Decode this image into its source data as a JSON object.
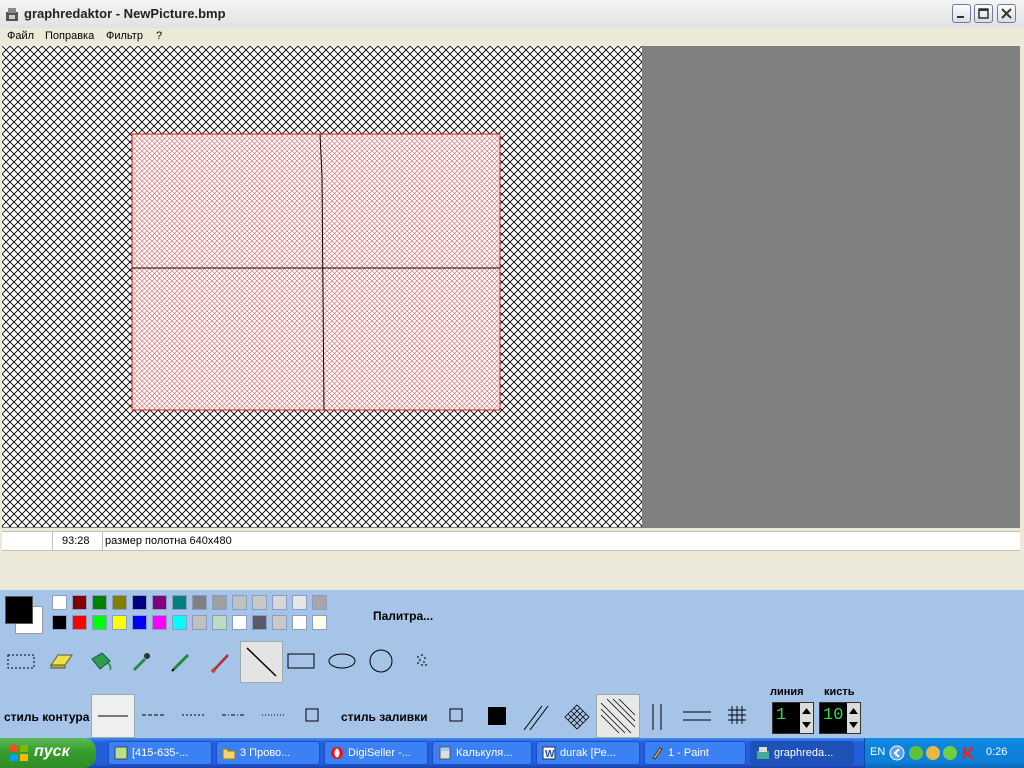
{
  "window": {
    "title": "graphredaktor - NewPicture.bmp"
  },
  "menu": {
    "items": [
      "Файл",
      "Поправка",
      "Фильтр",
      "?"
    ]
  },
  "status": {
    "cell1": "",
    "coords": "93:28",
    "message": "размер полотна 640x480"
  },
  "palette": {
    "label": "Палитра...",
    "primary": "#000000",
    "secondary": "#ffffff",
    "row1": [
      "#ffffff",
      "#800000",
      "#008000",
      "#808000",
      "#000080",
      "#800080",
      "#008080",
      "#808080",
      "#a0a0a0",
      "#c0c0c0",
      "#c8c8c8",
      "#d8d8d8",
      "#e6e6e6",
      "#a6a6a6"
    ],
    "row2": [
      "#000000",
      "#ff0000",
      "#00ff00",
      "#ffff00",
      "#0000ff",
      "#ff00ff",
      "#00ffff",
      "#c0c0c0",
      "#c0dcc0",
      "#ffffff",
      "#5a5a6a",
      "#c8c8c8",
      "#ffffff",
      "#ffffe8"
    ]
  },
  "tools": [
    "rect-select",
    "eraser",
    "fill",
    "eyedropper",
    "pencil",
    "brush",
    "line",
    "rectangle",
    "ellipse",
    "circle",
    "spray"
  ],
  "styles": {
    "outline_label": "стиль контура",
    "fill_label": "стиль заливки"
  },
  "spinners": {
    "line_label": "линия",
    "line_value": "1",
    "brush_label": "кисть",
    "brush_value": "10"
  },
  "taskbar": {
    "start_label": "пуск",
    "tasks": [
      {
        "label": "[415-635-..."
      },
      {
        "label": "3 Прово..."
      },
      {
        "label": "DigiSeller -..."
      },
      {
        "label": "Калькуля..."
      },
      {
        "label": "durak [Ре..."
      },
      {
        "label": "1 - Paint"
      },
      {
        "label": "graphreda..."
      }
    ],
    "lang": "EN",
    "clock": "0:26"
  }
}
